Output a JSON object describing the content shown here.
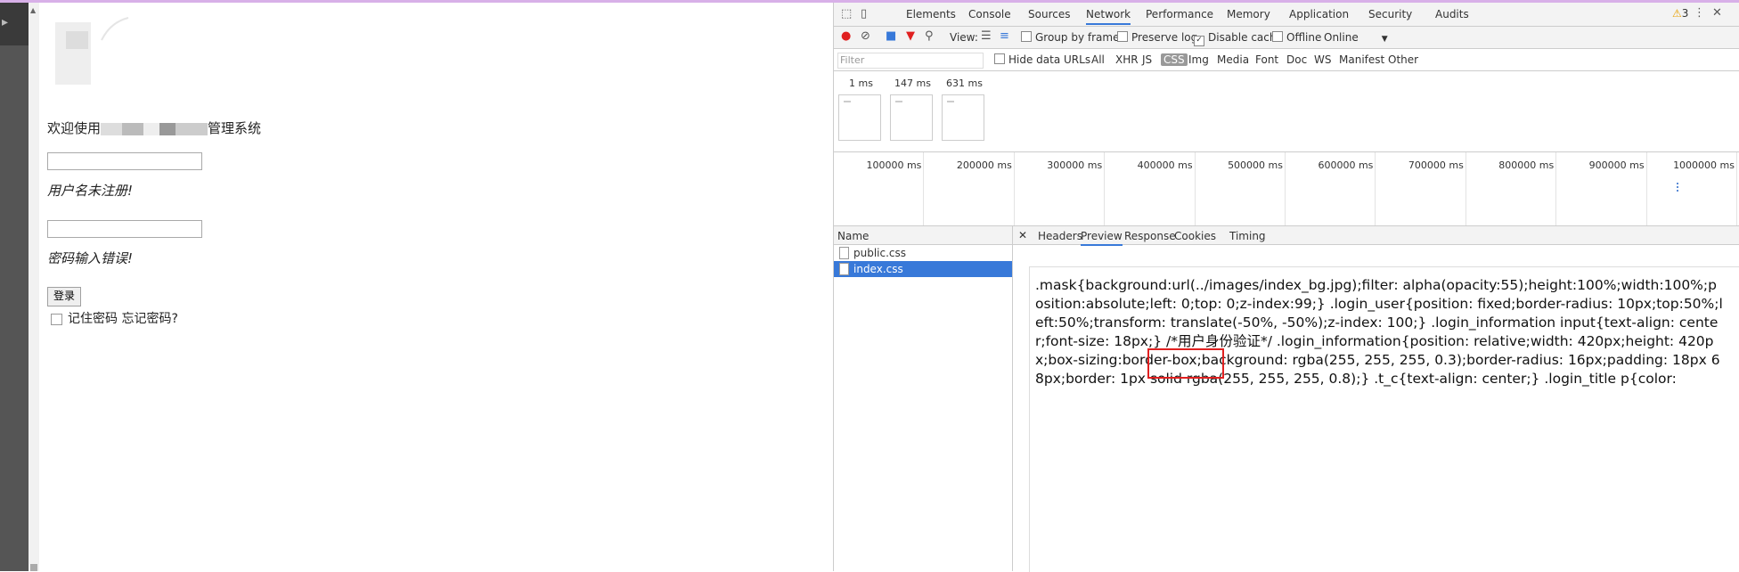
{
  "page": {
    "welcome_prefix": "欢迎使用",
    "welcome_suffix": "管理系统",
    "username_error": "用户名未注册!",
    "password_error": "密码输入错误!",
    "login_button": "登录",
    "remember_label": "记住密码",
    "forgot_label": "忘记密码?"
  },
  "devtools": {
    "tabs": [
      "Elements",
      "Console",
      "Sources",
      "Network",
      "Performance",
      "Memory",
      "Application",
      "Security",
      "Audits"
    ],
    "active_tab": "Network",
    "warning_count": "3",
    "toolbar": {
      "view_label": "View:",
      "group_by_frame": "Group by frame",
      "preserve_log": "Preserve log",
      "disable_cache": "Disable cache",
      "offline": "Offline",
      "throttle": "Online"
    },
    "filter": {
      "placeholder": "Filter",
      "hide_data_urls": "Hide data URLs",
      "types": [
        "All",
        "XHR",
        "JS",
        "CSS",
        "Img",
        "Media",
        "Font",
        "Doc",
        "WS",
        "Manifest",
        "Other"
      ],
      "selected": "CSS"
    },
    "filmstrip_times": [
      "1 ms",
      "147 ms",
      "631 ms"
    ],
    "timeline_ticks": [
      "100000 ms",
      "200000 ms",
      "300000 ms",
      "400000 ms",
      "500000 ms",
      "600000 ms",
      "700000 ms",
      "800000 ms",
      "900000 ms",
      "1000000 ms"
    ],
    "name_header": "Name",
    "files": [
      "public.css",
      "index.css"
    ],
    "selected_file": "index.css",
    "detail_tabs": [
      "Headers",
      "Preview",
      "Response",
      "Cookies",
      "Timing"
    ],
    "active_detail_tab": "Preview",
    "preview_text": ".mask{background:url(../images/index_bg.jpg);filter: alpha(opacity:55);height:100%;width:100%;position:absolute;left: 0;top: 0;z-index:99;} .login_user{position: fixed;border-radius: 10px;top:50%;left:50%;transform: translate(-50%, -50%);z-index: 100;} .login_information input{text-align: center;font-size: 18px;} /*用户身份验证*/ .login_information{position: relative;width: 420px;height: 420px;box-sizing:border-box;background: rgba(255, 255, 255, 0.3);border-radius: 16px;padding: 18px 68px;border: 1px solid rgba(255, 255, 255, 0.8);} .t_c{text-align: center;} .login_title p{color:"
  },
  "colors": {
    "accent": "#3879d9",
    "record": "#e02020",
    "highlight": "#e02020"
  }
}
